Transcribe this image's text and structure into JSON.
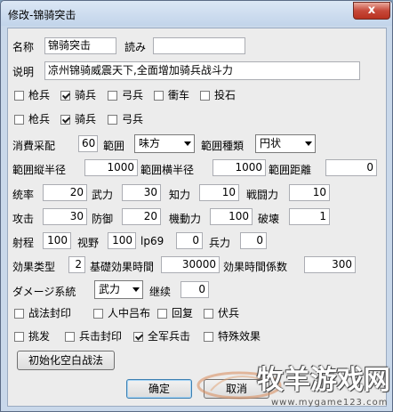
{
  "window": {
    "title": "修改-锦骑突击",
    "close_glyph": "x"
  },
  "fields": {
    "name_label": "名称",
    "name_value": "锦骑突击",
    "reading_label": "読み",
    "reading_value": "",
    "desc_label": "说明",
    "desc_value": "凉州锦骑威震天下,全面增加骑兵战斗力"
  },
  "row1": [
    {
      "label": "枪兵",
      "checked": false
    },
    {
      "label": "骑兵",
      "checked": true
    },
    {
      "label": "弓兵",
      "checked": false
    },
    {
      "label": "衝车",
      "checked": false
    },
    {
      "label": "投石",
      "checked": false
    }
  ],
  "row2": [
    {
      "label": "枪兵",
      "checked": false
    },
    {
      "label": "骑兵",
      "checked": true
    },
    {
      "label": "弓兵",
      "checked": false
    }
  ],
  "params": {
    "cost_label": "消費采配",
    "cost_value": "60",
    "range_label": "範囲",
    "range_select": "味方",
    "range_type_label": "範囲種類",
    "range_type_select": "円状",
    "v_radius_label": "範囲縦半径",
    "v_radius_value": "1000",
    "h_radius_label": "範囲横半径",
    "h_radius_value": "1000",
    "range_dist_label": "範囲距離",
    "range_dist_value": "0",
    "leadership_label": "统率",
    "leadership_value": "20",
    "force_label": "武力",
    "force_value": "30",
    "intel_label": "知力",
    "intel_value": "10",
    "battle_label": "戦闘力",
    "battle_value": "10",
    "attack_label": "攻击",
    "attack_value": "30",
    "defense_label": "防御",
    "defense_value": "20",
    "mobility_label": "機動力",
    "mobility_value": "100",
    "destroy_label": "破壊",
    "destroy_value": "1",
    "shoot_label": "射程",
    "shoot_value": "100",
    "sight_label": "视野",
    "sight_value": "100",
    "lp_label": "lp69",
    "lp_value": "0",
    "troops_label": "兵力",
    "troops_value": "0",
    "effect_type_label": "効果类型",
    "effect_type_value": "2",
    "base_time_label": "基礎効果時間",
    "base_time_value": "30000",
    "time_coef_label": "効果時間係数",
    "time_coef_value": "300",
    "damage_label": "ダメージ系統",
    "damage_select": "武力",
    "continue_label": "继续",
    "continue_value": "0"
  },
  "row3": [
    {
      "label": "战法封印",
      "checked": false
    },
    {
      "label": "人中吕布",
      "checked": false
    },
    {
      "label": "回复",
      "checked": false
    },
    {
      "label": "伏兵",
      "checked": false
    }
  ],
  "row4": [
    {
      "label": "挑发",
      "checked": false
    },
    {
      "label": "兵击封印",
      "checked": false
    },
    {
      "label": "全军兵击",
      "checked": true
    },
    {
      "label": "特殊效果",
      "checked": false
    }
  ],
  "buttons": {
    "init": "初始化空白战法",
    "ok": "确定",
    "cancel": "取消"
  },
  "watermark": {
    "text": "牧羊游戏网",
    "url": "www.mygame123.com"
  }
}
